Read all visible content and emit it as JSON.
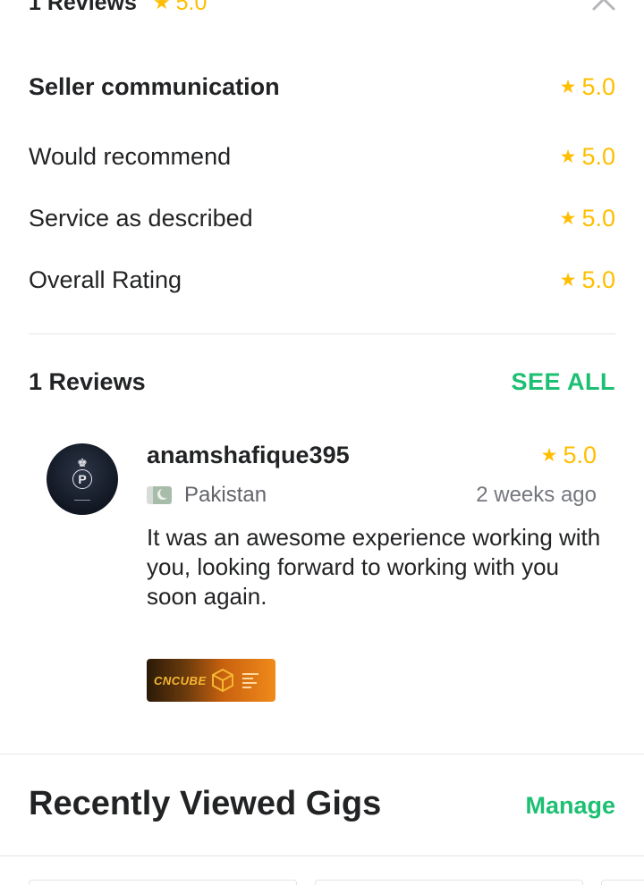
{
  "header": {
    "reviews_count": "1 Reviews",
    "overall_score": "5.0"
  },
  "ratings": [
    {
      "label": "Seller communication",
      "score": "5.0"
    },
    {
      "label": "Would recommend",
      "score": "5.0"
    },
    {
      "label": "Service as described",
      "score": "5.0"
    },
    {
      "label": "Overall Rating",
      "score": "5.0"
    }
  ],
  "reviews_section": {
    "title": "1 Reviews",
    "see_all": "SEE ALL"
  },
  "review": {
    "username": "anamshafique395",
    "score": "5.0",
    "country": "Pakistan",
    "time": "2 weeks ago",
    "comment": "It was an awesome experience working with you, looking forward to working with you soon again.",
    "attachment_text": "CNCUBE"
  },
  "recently_viewed": {
    "title": "Recently Viewed Gigs",
    "manage": "Manage"
  },
  "colors": {
    "accent_green": "#1dbf73",
    "star_yellow": "#ffbe00",
    "text_dark": "#222325",
    "text_muted": "#74767e"
  },
  "icons": {
    "close": "close-icon",
    "star": "star-icon",
    "flag": "pakistan-flag-icon"
  }
}
